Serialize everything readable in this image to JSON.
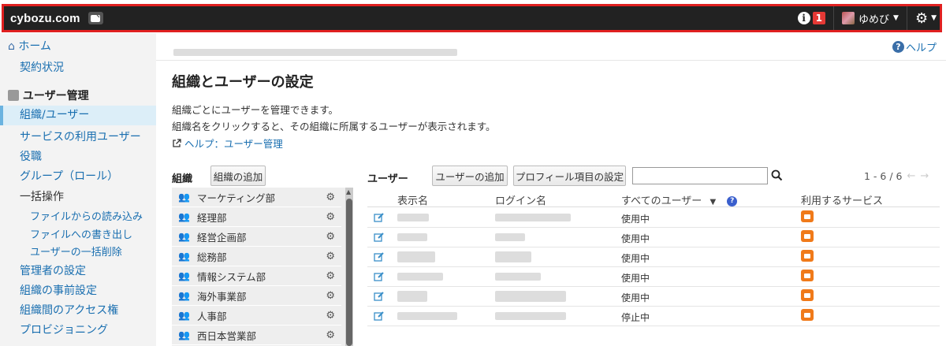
{
  "header": {
    "brand": "cybozu.com",
    "notification_count": "1",
    "username": "ゆめび"
  },
  "sidebar": {
    "home": "ホーム",
    "contract": "契約状況",
    "user_mgmt": "ユーザー管理",
    "items": [
      {
        "label": "組織/ユーザー"
      },
      {
        "label": "サービスの利用ユーザー"
      },
      {
        "label": "役職"
      },
      {
        "label": "グループ（ロール）"
      },
      {
        "label": "一括操作"
      }
    ],
    "sub_items": [
      {
        "label": "ファイルからの読み込み"
      },
      {
        "label": "ファイルへの書き出し"
      },
      {
        "label": "ユーザーの一括削除"
      }
    ],
    "more_items": [
      {
        "label": "管理者の設定"
      },
      {
        "label": "組織の事前設定"
      },
      {
        "label": "組織間のアクセス権"
      },
      {
        "label": "プロビジョニング"
      }
    ]
  },
  "main": {
    "help_top": "ヘルプ",
    "title": "組織とユーザーの設定",
    "desc1": "組織ごとにユーザーを管理できます。",
    "desc2": "組織名をクリックすると、その組織に所属するユーザーが表示されます。",
    "help_link": "ヘルプ：ユーザー管理",
    "org_label": "組織",
    "add_org": "組織の追加",
    "user_label": "ユーザー",
    "add_user": "ユーザーの追加",
    "profile_settings": "プロフィール項目の設定",
    "search_value": "",
    "pager": "1 - 6 / 6",
    "orgs": [
      {
        "name": "マーケティング部"
      },
      {
        "name": "経理部"
      },
      {
        "name": "経営企画部"
      },
      {
        "name": "総務部"
      },
      {
        "name": "情報システム部"
      },
      {
        "name": "海外事業部"
      },
      {
        "name": "人事部"
      },
      {
        "name": "西日本営業部"
      }
    ],
    "columns": {
      "display_name": "表示名",
      "login_name": "ログイン名",
      "all_users": "すべてのユーザー",
      "services": "利用するサービス"
    },
    "users": [
      {
        "status": "使用中"
      },
      {
        "status": "使用中"
      },
      {
        "status": "使用中"
      },
      {
        "status": "使用中"
      },
      {
        "status": "使用中"
      },
      {
        "status": "停止中"
      }
    ]
  },
  "colors": {
    "header_bg": "#222222",
    "highlight_border": "#e02020",
    "link": "#1a6fb0",
    "service_icon": "#f07a1a",
    "badge": "#e53935"
  }
}
